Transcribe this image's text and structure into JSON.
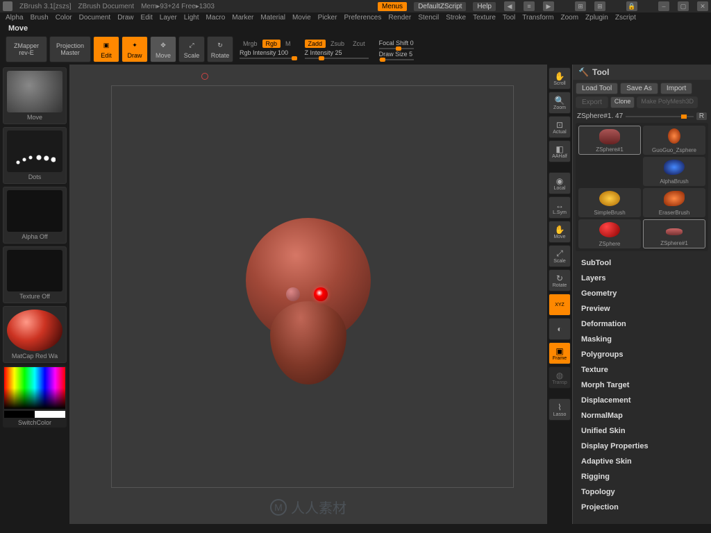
{
  "title": {
    "app": "ZBrush 3.1[zszs]",
    "doc": "ZBrush Document",
    "mem": "Mem▸93+24 Free▸1303"
  },
  "topbtns": {
    "menus": "Menus",
    "zscript": "DefaultZScript",
    "help": "Help"
  },
  "menus": [
    "Alpha",
    "Brush",
    "Color",
    "Document",
    "Draw",
    "Edit",
    "Layer",
    "Light",
    "Macro",
    "Marker",
    "Material",
    "Movie",
    "Picker",
    "Preferences",
    "Render",
    "Stencil",
    "Stroke",
    "Texture",
    "Tool",
    "Transform",
    "Zoom",
    "Zplugin",
    "Zscript"
  ],
  "mode": "Move",
  "toolbar": {
    "zmapper": "ZMapper",
    "zmapper2": "rev-E",
    "proj1": "Projection",
    "proj2": "Master",
    "edit": "Edit",
    "draw": "Draw",
    "move": "Move",
    "scale": "Scale",
    "rotate": "Rotate",
    "mrgb": "Mrgb",
    "rgb": "Rgb",
    "m": "M",
    "rgbint": "Rgb Intensity 100",
    "zadd": "Zadd",
    "zsub": "Zsub",
    "zcut": "Zcut",
    "zint": "Z Intensity 25",
    "focal": "Focal Shift 0",
    "drawsize": "Draw Size 5"
  },
  "left": {
    "brush": "Move",
    "stroke": "Dots",
    "alpha": "Alpha Off",
    "tex": "Texture Off",
    "mat": "MatCap Red Wa",
    "switch": "SwitchColor"
  },
  "rside": [
    "Scroll",
    "Zoom",
    "Actual",
    "AAHalf",
    "Local",
    "L.Sym",
    "Move",
    "Scale",
    "Rotate",
    "XYZ",
    "",
    "Frame",
    "Transp",
    "Lasso"
  ],
  "tool": {
    "title": "Tool",
    "load": "Load Tool",
    "save": "Save As",
    "import": "Import",
    "export": "Export",
    "clone": "Clone",
    "makepoly": "Make PolyMesh3D",
    "name": "ZSphere#1. 47",
    "r": "R",
    "grid": [
      "ZSphere#1",
      "GuoGuo_Zsphere",
      "AlphaBrush",
      "SimpleBrush",
      "EraserBrush",
      "ZSphere",
      "ZSphere#1"
    ],
    "sections": [
      "SubTool",
      "Layers",
      "Geometry",
      "Preview",
      "Deformation",
      "Masking",
      "Polygroups",
      "Texture",
      "Morph Target",
      "Displacement",
      "NormalMap",
      "Unified Skin",
      "Display Properties",
      "Adaptive Skin",
      "Rigging",
      "Topology",
      "Projection"
    ]
  },
  "watermark": "人人素材"
}
